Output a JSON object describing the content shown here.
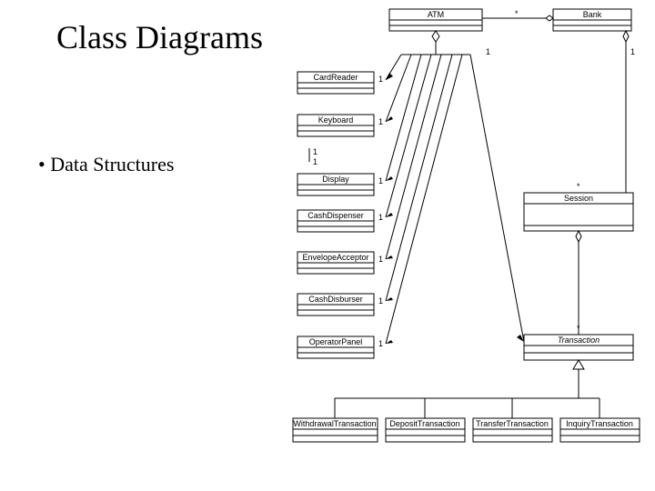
{
  "title": "Class Diagrams",
  "bullet": "Data Structures",
  "classes": {
    "atm": "ATM",
    "bank": "Bank",
    "cardreader": "CardReader",
    "keyboard": "Keyboard",
    "display": "Display",
    "cashdispenser": "CashDispenser",
    "envelopeacceptor": "EnvelopeAcceptor",
    "cashdisburser": "CashDisburser",
    "operatorpanel": "OperatorPanel",
    "session": "Session",
    "transaction": "Transaction",
    "withdrawal": "WithdrawalTransaction",
    "deposit": "DepositTransaction",
    "transfer": "TransferTransaction",
    "inquiry": "InquiryTransaction"
  },
  "multiplicities": {
    "one": "1",
    "star": "*"
  }
}
